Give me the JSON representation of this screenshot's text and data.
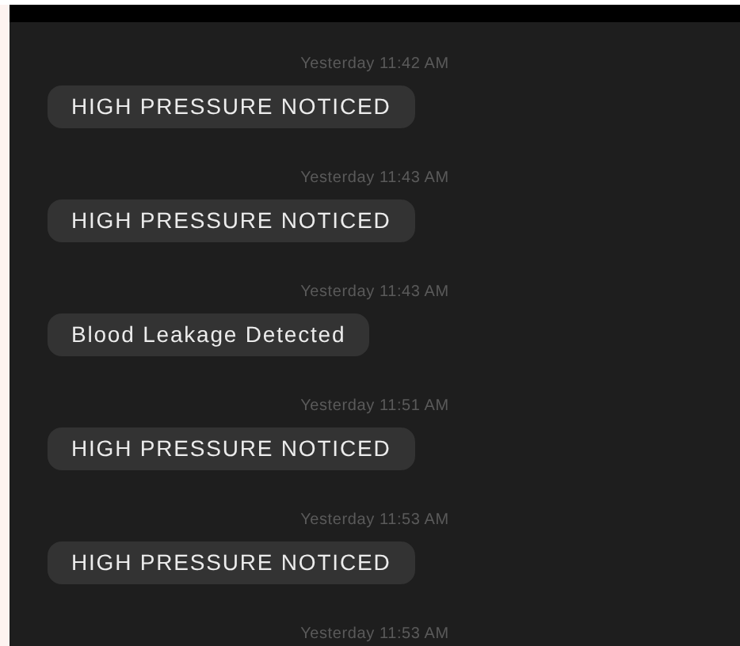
{
  "messages": [
    {
      "time": "Yesterday 11:42 AM",
      "text": "HIGH PRESSURE NOTICED"
    },
    {
      "time": "Yesterday 11:43 AM",
      "text": "HIGH PRESSURE NOTICED"
    },
    {
      "time": "Yesterday 11:43 AM",
      "text": "Blood Leakage Detected"
    },
    {
      "time": "Yesterday 11:51 AM",
      "text": "HIGH PRESSURE NOTICED"
    },
    {
      "time": "Yesterday 11:53 AM",
      "text": "HIGH PRESSURE NOTICED"
    },
    {
      "time": "Yesterday 11:53 AM"
    }
  ]
}
